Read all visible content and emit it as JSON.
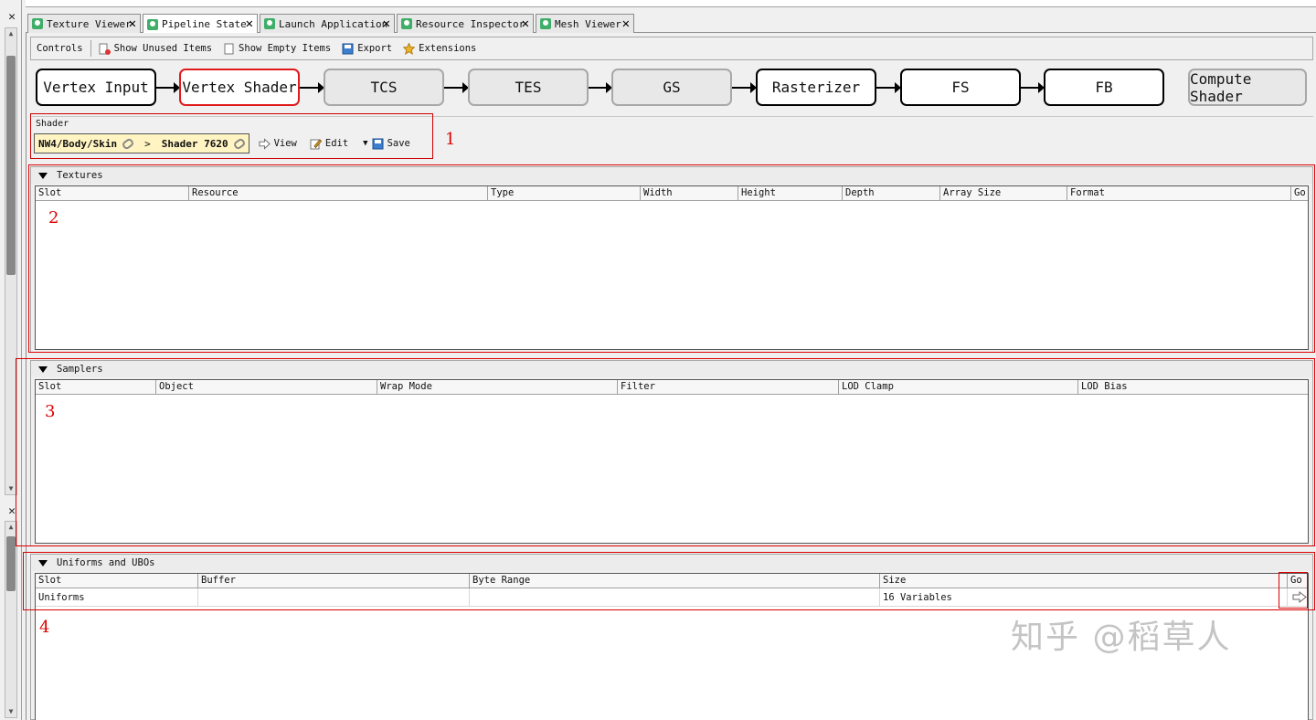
{
  "tabs": [
    {
      "label": "Texture Viewer",
      "active": false
    },
    {
      "label": "Pipeline State",
      "active": true
    },
    {
      "label": "Launch Application",
      "active": false
    },
    {
      "label": "Resource Inspector",
      "active": false
    },
    {
      "label": "Mesh Viewer",
      "active": false
    }
  ],
  "toolbar": {
    "controls_label": "Controls",
    "show_unused_label": "Show Unused Items",
    "show_empty_label": "Show Empty Items",
    "export_label": "Export",
    "extensions_label": "Extensions"
  },
  "pipeline": {
    "stages": [
      {
        "label": "Vertex Input",
        "state": "enabled"
      },
      {
        "label": "Vertex Shader",
        "state": "selected"
      },
      {
        "label": "TCS",
        "state": "disabled"
      },
      {
        "label": "TES",
        "state": "disabled"
      },
      {
        "label": "GS",
        "state": "disabled"
      },
      {
        "label": "Rasterizer",
        "state": "enabled"
      },
      {
        "label": "FS",
        "state": "enabled"
      },
      {
        "label": "FB",
        "state": "enabled"
      },
      {
        "label": "Compute Shader",
        "state": "disabled"
      }
    ]
  },
  "shader": {
    "group_label": "Shader",
    "path_part1": "NW4/Body/Skin",
    "separator": ">",
    "path_part2": "Shader 7620",
    "view_label": "View",
    "edit_label": "Edit",
    "save_label": "Save"
  },
  "annotations": {
    "a1": "1",
    "a2": "2",
    "a3": "3",
    "a4": "4"
  },
  "textures": {
    "title": "Textures",
    "columns": [
      "Slot",
      "Resource",
      "Type",
      "Width",
      "Height",
      "Depth",
      "Array Size",
      "Format",
      "Go"
    ]
  },
  "samplers": {
    "title": "Samplers",
    "columns": [
      "Slot",
      "Object",
      "Wrap Mode",
      "Filter",
      "LOD Clamp",
      "LOD Bias"
    ]
  },
  "uniforms": {
    "title": "Uniforms and UBOs",
    "columns": [
      "Slot",
      "Buffer",
      "Byte Range",
      "Size",
      "Go"
    ],
    "rows": [
      {
        "slot": "Uniforms",
        "buffer": "",
        "byte_range": "",
        "size": "16 Variables"
      }
    ]
  },
  "watermark": "知乎 @稻草人",
  "colors": {
    "selected_border": "#e01a1a",
    "annotation": "#d00000",
    "tab_icon": "#3fae69",
    "shader_path_bg": "#fff4c2"
  }
}
